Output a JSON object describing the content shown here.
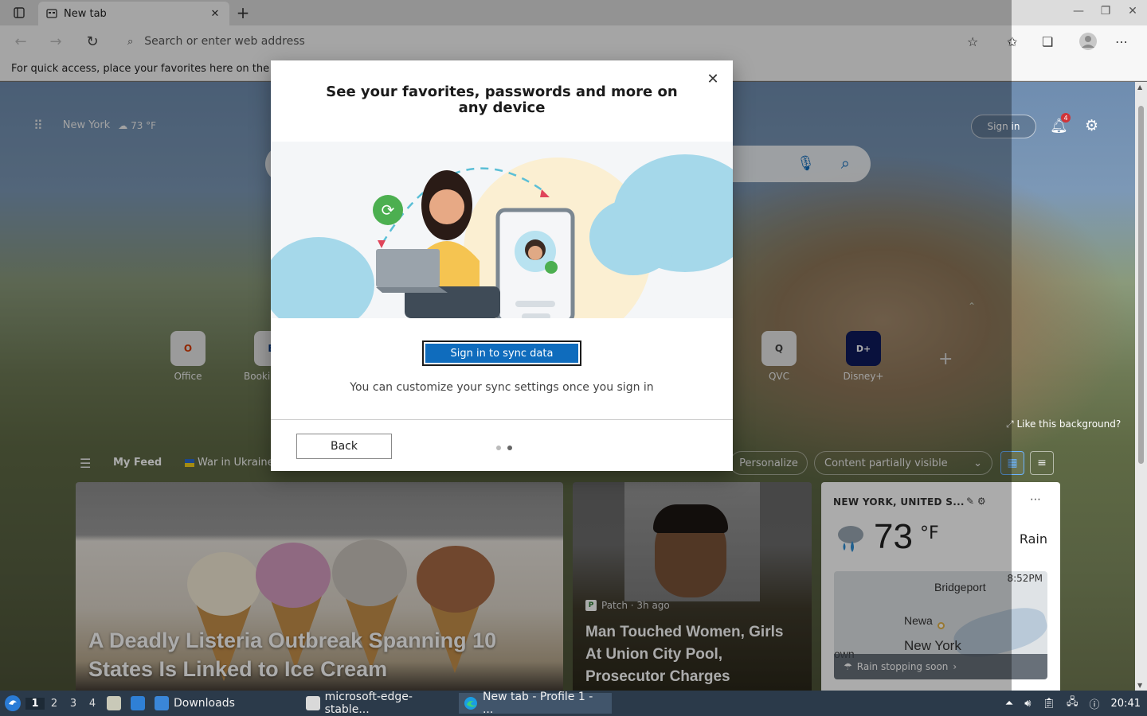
{
  "window": {
    "tab_title": "New tab",
    "minimize_label": "—",
    "restore_label": "❐",
    "close_label": "✕"
  },
  "toolbar": {
    "address_placeholder": "Search or enter web address"
  },
  "favorites_bar": {
    "text": "For quick access, place your favorites here on the"
  },
  "ntp": {
    "location": "New York",
    "mini_temp": "73 °F",
    "signin_label": "Sign in",
    "notification_count": "4",
    "tiles": [
      {
        "label": "Office",
        "glyph": "O",
        "color": "#d83b01"
      },
      {
        "label": "Booking.com",
        "glyph": "B",
        "color": "#003580"
      },
      {
        "label": "QVC",
        "glyph": "Q",
        "color": "#444444"
      },
      {
        "label": "Disney+",
        "glyph": "D+",
        "color": "#0e1a5c"
      }
    ],
    "like_background": "Like this background?",
    "feed": {
      "my_feed": "My Feed",
      "war_in_ukraine": "War in Ukraine",
      "personalize": "Personalize",
      "content_visibility": "Content partially visible"
    },
    "cards": {
      "icecream_title": "A Deadly Listeria Outbreak Spanning 10 States Is Linked to Ice Cream",
      "patch_source": "Patch · 3h ago",
      "patch_title": "Man Touched Women, Girls At Union City Pool, Prosecutor Charges"
    },
    "weather": {
      "location": "NEW YORK, UNITED S...",
      "temp": "73",
      "unit": "°F",
      "condition": "Rain",
      "map_time": "8:52PM",
      "map_labels": [
        "Bridgeport",
        "Newa",
        "New York",
        "own"
      ],
      "footer": "Rain stopping soon"
    }
  },
  "dialog": {
    "title": "See your favorites, passwords and more on any device",
    "primary_button": "Sign in to sync data",
    "subtitle": "You can customize your sync settings once you sign in",
    "back_button": "Back",
    "close_label": "✕"
  },
  "taskbar": {
    "workspaces": [
      "1",
      "2",
      "3",
      "4"
    ],
    "items": [
      {
        "label": "Downloads"
      },
      {
        "label": "microsoft-edge-stable..."
      },
      {
        "label": "New tab - Profile 1 - ..."
      }
    ],
    "clock": "20:41"
  }
}
